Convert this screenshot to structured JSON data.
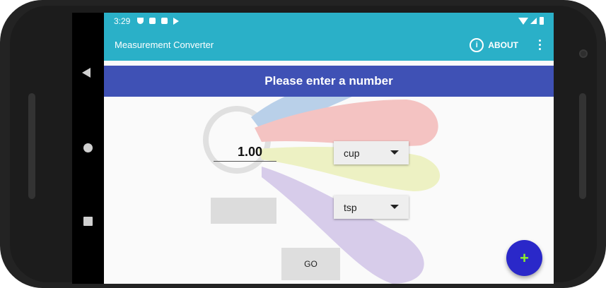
{
  "status_bar": {
    "time": "3:29",
    "icons": [
      "shield-icon",
      "photo-icon",
      "sd-card-icon",
      "play-store-icon"
    ],
    "right_icons": [
      "wifi-icon",
      "signal-icon",
      "battery-icon"
    ]
  },
  "app_bar": {
    "title": "Measurement Converter",
    "about_label": "ABOUT",
    "about_icon": "info-icon",
    "overflow_icon": "overflow-menu-icon",
    "background_color": "#2ab0c8"
  },
  "main": {
    "prompt": "Please enter a number",
    "prompt_color": "#3f51b5",
    "input_value": "1.00",
    "from_unit": "cup",
    "to_unit": "tsp",
    "result": "",
    "go_label": "GO",
    "fab_symbol": "+",
    "fab_color": "#2a28c9"
  },
  "nav_bar": {
    "icons": [
      "back-icon",
      "home-icon",
      "recents-icon"
    ]
  }
}
